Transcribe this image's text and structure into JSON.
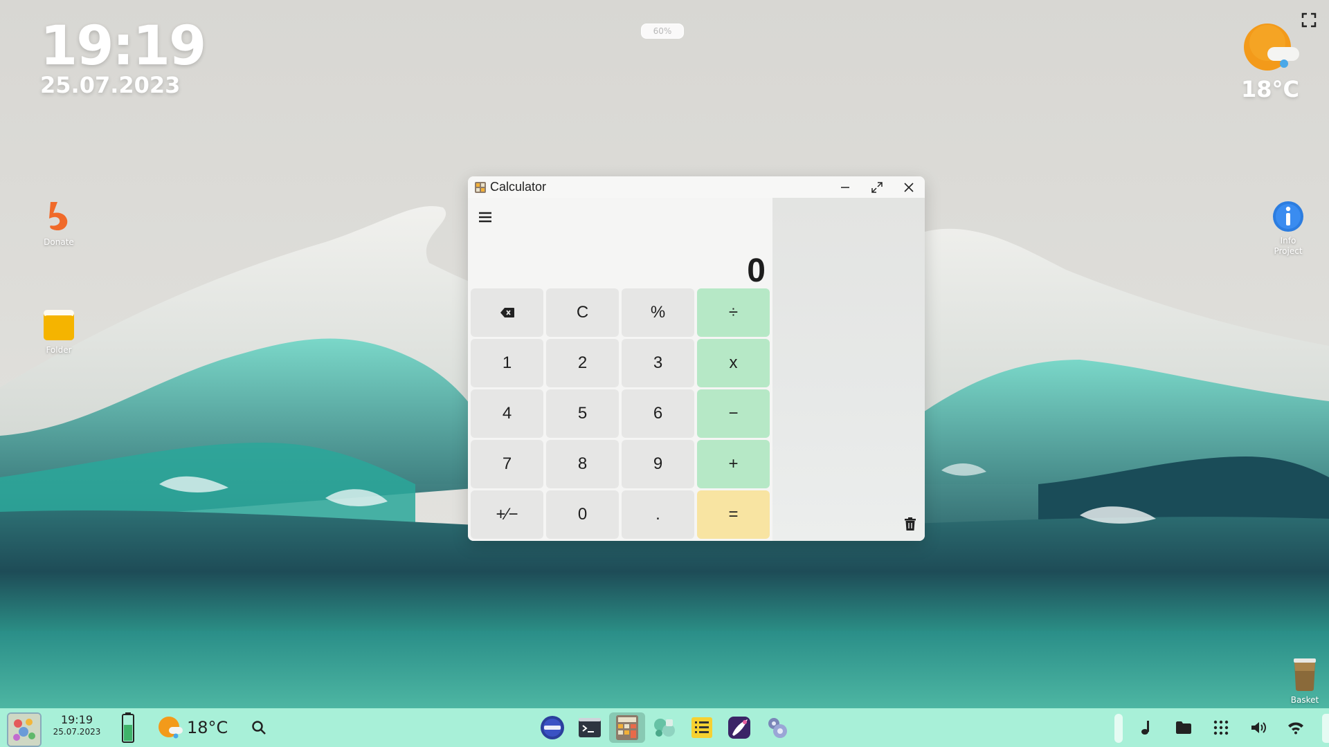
{
  "desktop": {
    "clock_time": "19:19",
    "clock_date": "25.07.2023",
    "battery_label": "60%",
    "weather_temp": "18°C",
    "icons": [
      {
        "label": "Donate"
      },
      {
        "label": "Folder"
      },
      {
        "label": "Info\nProject"
      },
      {
        "label": "Basket"
      }
    ]
  },
  "window": {
    "title": "Calculator",
    "display_value": "0",
    "keys": [
      {
        "label": "⌫",
        "kind": "num"
      },
      {
        "label": "C",
        "kind": "num"
      },
      {
        "label": "%",
        "kind": "num"
      },
      {
        "label": "÷",
        "kind": "op"
      },
      {
        "label": "1",
        "kind": "num"
      },
      {
        "label": "2",
        "kind": "num"
      },
      {
        "label": "3",
        "kind": "num"
      },
      {
        "label": "x",
        "kind": "op"
      },
      {
        "label": "4",
        "kind": "num"
      },
      {
        "label": "5",
        "kind": "num"
      },
      {
        "label": "6",
        "kind": "num"
      },
      {
        "label": "−",
        "kind": "op"
      },
      {
        "label": "7",
        "kind": "num"
      },
      {
        "label": "8",
        "kind": "num"
      },
      {
        "label": "9",
        "kind": "num"
      },
      {
        "label": "+",
        "kind": "op"
      },
      {
        "label": "+⁄−",
        "kind": "num"
      },
      {
        "label": "0",
        "kind": "num"
      },
      {
        "label": ".",
        "kind": "num"
      },
      {
        "label": "=",
        "kind": "eq"
      }
    ]
  },
  "taskbar": {
    "clock_time": "19:19",
    "clock_date": "25.07.2023",
    "battery_label": "60%",
    "weather_temp": "18°C",
    "apps": [
      "browser-icon",
      "terminal-icon",
      "calculator-icon",
      "games-icon",
      "notes-icon",
      "paint-icon",
      "settings-icon"
    ],
    "tray": [
      "music-icon",
      "folder-icon",
      "apps-grid-icon",
      "volume-icon",
      "wifi-icon"
    ]
  },
  "colors": {
    "taskbar": "#a8f0d8",
    "operator_key": "#b6e8c6",
    "equals_key": "#f8e4a2",
    "number_key": "#e6e6e5"
  }
}
